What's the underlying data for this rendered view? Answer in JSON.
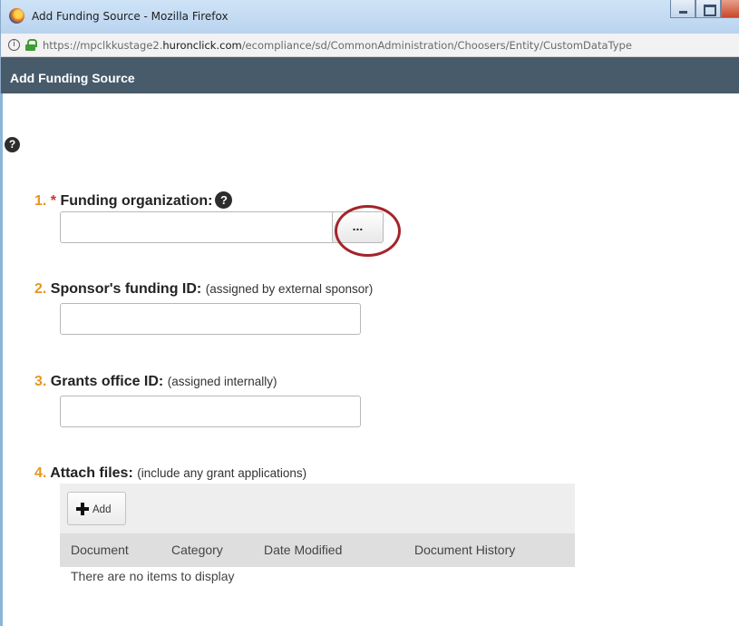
{
  "window": {
    "title": "Add Funding Source - Mozilla Firefox",
    "url_prefix": "https://mpclkkustage2.",
    "url_domain": "huronclick.com",
    "url_path": "/ecompliance/sd/CommonAdministration/Choosers/Entity/CustomDataType"
  },
  "dialog": {
    "title": "Add Funding Source"
  },
  "questions": [
    {
      "num": "1.",
      "required": "*",
      "label": "Funding organization:",
      "hint": ""
    },
    {
      "num": "2.",
      "required": "",
      "label": "Sponsor's funding ID:",
      "hint": "(assigned by external sponsor)"
    },
    {
      "num": "3.",
      "required": "",
      "label": "Grants office ID:",
      "hint": "(assigned internally)"
    },
    {
      "num": "4.",
      "required": "",
      "label": "Attach files:",
      "hint": "(include any grant applications)"
    }
  ],
  "inputs": {
    "funding_org_value": "",
    "sponsor_id_value": "",
    "grants_office_id_value": ""
  },
  "chooser_button_label": "...",
  "attachments": {
    "add_label": "Add",
    "columns": [
      "Document",
      "Category",
      "Date Modified",
      "Document History"
    ],
    "empty_message": "There are no items to display"
  },
  "colors": {
    "header_bg": "#475b6b",
    "number_accent": "#e8961e",
    "required_star": "#d32f2f",
    "highlight_ring": "#a3252a"
  }
}
